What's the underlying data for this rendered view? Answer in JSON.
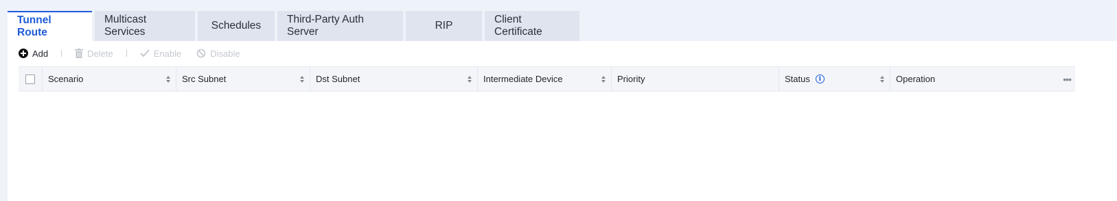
{
  "tabs": [
    {
      "label": "Tunnel Route",
      "active": true
    },
    {
      "label": "Multicast Services",
      "active": false
    },
    {
      "label": "Schedules",
      "active": false
    },
    {
      "label": "Third-Party Auth Server",
      "active": false
    },
    {
      "label": "RIP",
      "active": false
    },
    {
      "label": "Client Certificate",
      "active": false
    }
  ],
  "toolbar": {
    "add": "Add",
    "delete": "Delete",
    "enable": "Enable",
    "disable": "Disable"
  },
  "table": {
    "columns": [
      {
        "label": "Scenario",
        "sortable": true
      },
      {
        "label": "Src Subnet",
        "sortable": true
      },
      {
        "label": "Dst Subnet",
        "sortable": true
      },
      {
        "label": "Intermediate Device",
        "sortable": true
      },
      {
        "label": "Priority",
        "sortable": false
      },
      {
        "label": "Status",
        "sortable": true,
        "info": true
      },
      {
        "label": "Operation",
        "sortable": false
      }
    ],
    "rows": []
  },
  "colors": {
    "accent": "#1d5ad8",
    "tab_inactive_bg": "#dfe4ee",
    "page_bg": "#eef2f9",
    "disabled_text": "#c4c8cf"
  },
  "icons": {
    "add": "plus-circle-icon",
    "delete": "trash-icon",
    "enable": "check-icon",
    "disable": "ban-icon",
    "status_info": "info-icon",
    "column_settings": "more-horizontal-icon"
  }
}
